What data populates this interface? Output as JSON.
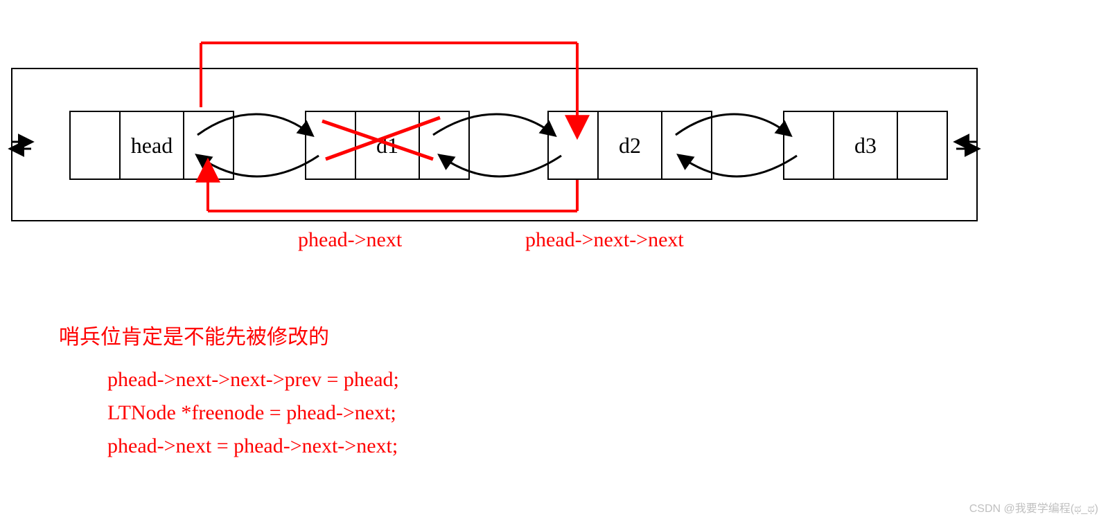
{
  "diagram": {
    "nodes": {
      "head": "head",
      "d1": "d1",
      "d2": "d2",
      "d3": "d3"
    },
    "pointer_labels": {
      "phead_next": "phead->next",
      "phead_next_next": "phead->next->next"
    }
  },
  "explanation": {
    "heading": "哨兵位肯定是不能先被修改的",
    "code_line_1": "phead->next->next->prev = phead;",
    "code_line_2": "LTNode *freenode = phead->next;",
    "code_line_3": "phead->next = phead->next->next;"
  },
  "watermark": "CSDN @我要学编程(ಥ_ಥ)"
}
